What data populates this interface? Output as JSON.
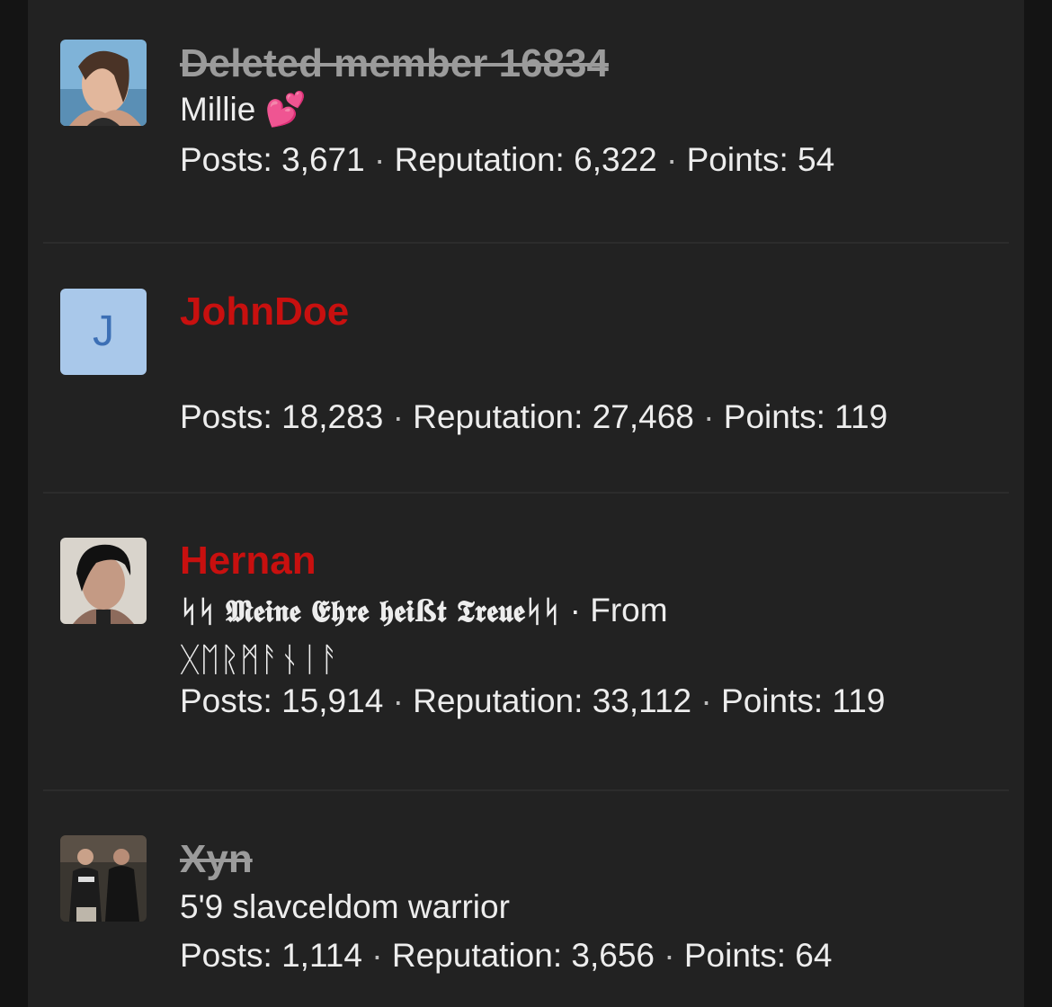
{
  "members": [
    {
      "name": "Deleted member 16834",
      "name_style": "deleted",
      "avatar": "photo-woman-beach",
      "title": "Millie 💕",
      "title_extra": "",
      "title_line2": "",
      "stats": {
        "posts_label": "Posts:",
        "posts": "3,671",
        "reputation_label": "Reputation:",
        "reputation": "6,322",
        "points_label": "Points:",
        "points": "54"
      }
    },
    {
      "name": "JohnDoe",
      "name_style": "staff-red",
      "avatar_letter": "J",
      "title": "",
      "stats": {
        "posts_label": "Posts:",
        "posts": "18,283",
        "reputation_label": "Reputation:",
        "reputation": "27,468",
        "points_label": "Points:",
        "points": "119"
      }
    },
    {
      "name": "Hernan",
      "name_style": "staff-red",
      "avatar": "photo-man-dark-hair",
      "title": "ᛋᛋ 𝕸𝖊𝖎𝖓𝖊 𝕰𝖍𝖗𝖊 𝖍𝖊𝖎ß𝖙 𝕿𝖗𝖊𝖚𝖊ᛋᛋ",
      "title_extra": " · From",
      "title_line2": "ᚷᛖᚱᛗᚨᚾᛁᚨ",
      "stats": {
        "posts_label": "Posts:",
        "posts": "15,914",
        "reputation_label": "Reputation:",
        "reputation": "33,112",
        "points_label": "Points:",
        "points": "119"
      }
    },
    {
      "name": "Xyn",
      "name_style": "deleted",
      "avatar": "photo-two-men-night",
      "title": "5'9 slavceldom warrior",
      "stats": {
        "posts_label": "Posts:",
        "posts": "1,114",
        "reputation_label": "Reputation:",
        "reputation": "3,656",
        "points_label": "Points:",
        "points": "64"
      }
    }
  ],
  "separator": "·",
  "colors": {
    "background": "#141414",
    "panel": "#222222",
    "staff_red": "#c8100f",
    "deleted_gray": "#9b9b9b",
    "text": "#ededed"
  }
}
